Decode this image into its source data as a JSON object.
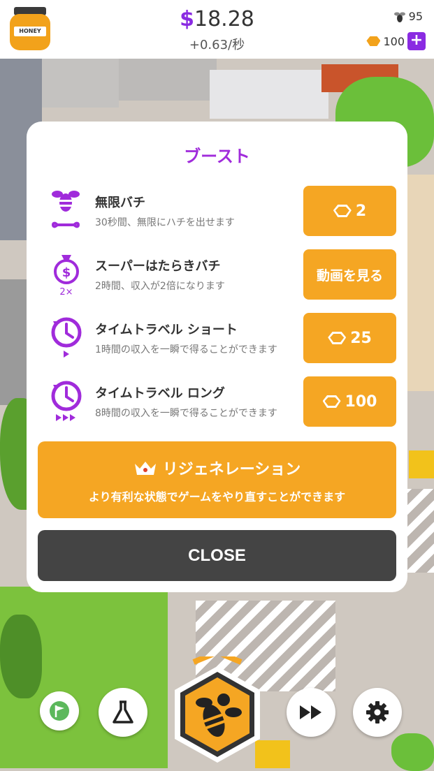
{
  "hud": {
    "jar_label": "HONEY",
    "money_symbol": "$",
    "money_value": "18.28",
    "rate": "+0.63/秒",
    "bee_count": "95",
    "gem_count": "100",
    "plus_label": "+"
  },
  "modal": {
    "title": "ブースト",
    "items": [
      {
        "name": "無限バチ",
        "desc": "30秒間、無限にハチを出せます",
        "button": "2",
        "icon": "infinite-bee-icon",
        "cost_type": "gem"
      },
      {
        "name": "スーパーはたらきバチ",
        "desc": "2時間、収入が2倍になります",
        "button": "動画を見る",
        "icon": "money-bag-icon",
        "icon_text": "2×",
        "cost_type": "video"
      },
      {
        "name": "タイムトラベル ショート",
        "desc": "1時間の収入を一瞬で得ることができます",
        "button": "25",
        "icon": "time-travel-short-icon",
        "cost_type": "gem"
      },
      {
        "name": "タイムトラベル ロング",
        "desc": "8時間の収入を一瞬で得ることができます",
        "button": "100",
        "icon": "time-travel-long-icon",
        "cost_type": "gem"
      }
    ],
    "regeneration": {
      "title": "リジェネレーション",
      "subtitle": "より有利な状態でゲームをやり直すことができます"
    },
    "close_label": "CLOSE"
  },
  "bottom_bar": {
    "buttons": [
      "flag-icon",
      "flask-icon",
      "bee-hive-icon",
      "fast-forward-icon",
      "gear-icon"
    ]
  },
  "colors": {
    "accent_purple": "#a02bdb",
    "button_orange": "#f5a623",
    "close_dark": "#444444"
  }
}
